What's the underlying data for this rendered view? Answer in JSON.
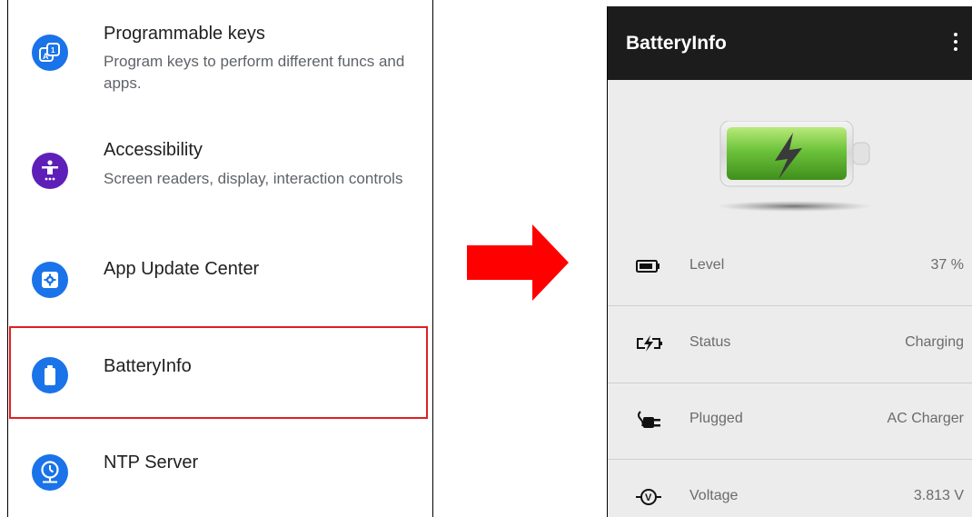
{
  "settings": {
    "items": [
      {
        "title": "Programmable keys",
        "subtitle": "Program keys to perform different funcs and apps.",
        "color": "#1a73e8"
      },
      {
        "title": "Accessibility",
        "subtitle": "Screen readers, display, interaction controls",
        "color": "#5e1fb8"
      },
      {
        "title": "App Update Center",
        "subtitle": "",
        "color": "#1a73e8"
      },
      {
        "title": "BatteryInfo",
        "subtitle": "",
        "color": "#1a73e8"
      },
      {
        "title": "NTP Server",
        "subtitle": "",
        "color": "#1a73e8"
      }
    ]
  },
  "battery_app": {
    "title": "BatteryInfo",
    "rows": [
      {
        "label": "Level",
        "value": "37 %",
        "icon": "battery-level-icon"
      },
      {
        "label": "Status",
        "value": "Charging",
        "icon": "charging-status-icon"
      },
      {
        "label": "Plugged",
        "value": "AC Charger",
        "icon": "plug-icon"
      },
      {
        "label": "Voltage",
        "value": "3.813 V",
        "icon": "voltage-icon"
      }
    ]
  },
  "colors": {
    "highlight": "#e02020",
    "arrow": "#ff0000",
    "app_bar": "#1c1c1c",
    "battery_green": "#6cc23a"
  }
}
